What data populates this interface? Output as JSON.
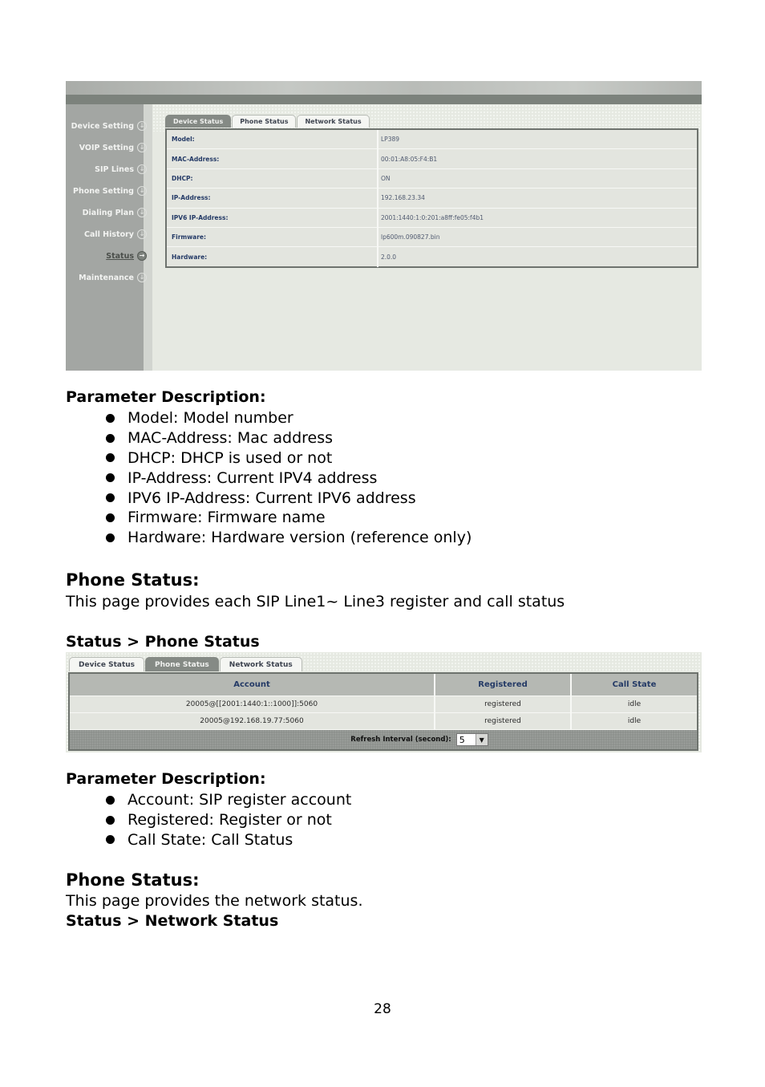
{
  "device_status_screenshot": {
    "sidebar": {
      "items": [
        {
          "label": "Device Setting",
          "icon": "circle-arrow-down-icon",
          "active": false
        },
        {
          "label": "VOIP Setting",
          "icon": "circle-arrow-down-icon",
          "active": false
        },
        {
          "label": "SIP Lines",
          "icon": "circle-arrow-down-icon",
          "active": false
        },
        {
          "label": "Phone Setting",
          "icon": "circle-arrow-down-icon",
          "active": false
        },
        {
          "label": "Dialing Plan",
          "icon": "circle-arrow-down-icon",
          "active": false
        },
        {
          "label": "Call History",
          "icon": "circle-arrow-down-icon",
          "active": false
        },
        {
          "label": "Status",
          "icon": "circle-arrow-right-icon",
          "active": true
        },
        {
          "label": "Maintenance",
          "icon": "circle-arrow-down-icon",
          "active": false
        }
      ],
      "icon_glyphs": {
        "down": "↓",
        "right": "→"
      }
    },
    "tabs": [
      {
        "label": "Device Status",
        "active": true
      },
      {
        "label": "Phone Status",
        "active": false
      },
      {
        "label": "Network Status",
        "active": false
      }
    ],
    "rows": [
      {
        "key": "Model:",
        "value": "LP389"
      },
      {
        "key": "MAC-Address:",
        "value": "00:01:A8:05:F4:B1"
      },
      {
        "key": "DHCP:",
        "value": "ON"
      },
      {
        "key": "IP-Address:",
        "value": "192.168.23.34"
      },
      {
        "key": "IPV6 IP-Address:",
        "value": "2001:1440:1:0:201:a8ff:fe05:f4b1"
      },
      {
        "key": "Firmware:",
        "value": "lp600m.090827.bin"
      },
      {
        "key": "Hardware:",
        "value": "2.0.0"
      }
    ]
  },
  "section1": {
    "heading": "Parameter Description:",
    "bullets": [
      "Model: Model number",
      "MAC-Address: Mac address",
      "DHCP: DHCP is used or not",
      "IP-Address: Current IPV4 address",
      "IPV6 IP-Address: Current IPV6 address",
      "Firmware: Firmware name",
      "Hardware: Hardware version (reference only)"
    ]
  },
  "section2": {
    "heading": "Phone Status:",
    "text": "This page provides each SIP Line1~ Line3 register and call status",
    "breadcrumb": "Status > Phone Status"
  },
  "phone_status_screenshot": {
    "tabs": [
      {
        "label": "Device Status",
        "active": false
      },
      {
        "label": "Phone Status",
        "active": true
      },
      {
        "label": "Network Status",
        "active": false
      }
    ],
    "columns": [
      "Account",
      "Registered",
      "Call State"
    ],
    "rows": [
      [
        "20005@[[2001:1440:1::1000]]:5060",
        "registered",
        "idle"
      ],
      [
        "20005@192.168.19.77:5060",
        "registered",
        "idle"
      ]
    ],
    "refresh_label": "Refresh Interval (second):",
    "refresh_value": "5",
    "dropdown_icon": "▼"
  },
  "section3": {
    "heading": "Parameter Description:",
    "bullets": [
      "Account: SIP register account",
      "Registered: Register or not",
      "Call State: Call Status"
    ]
  },
  "section4": {
    "heading": "Phone Status:",
    "text": "This page provides the network status.",
    "breadcrumb": "Status > Network Status"
  },
  "page_number": "28"
}
